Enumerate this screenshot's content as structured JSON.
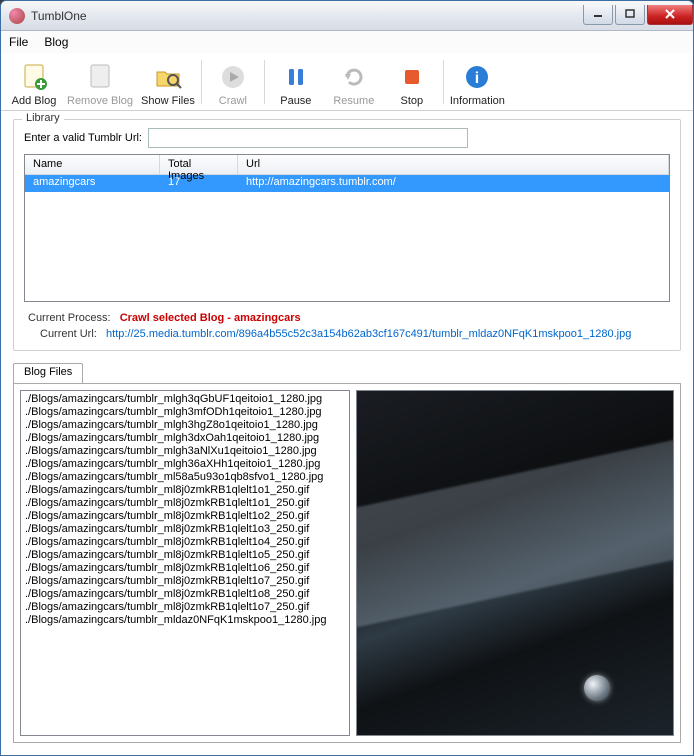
{
  "window": {
    "title": "TumblOne"
  },
  "menu": {
    "file": "File",
    "blog": "Blog"
  },
  "toolbar": {
    "add": "Add Blog",
    "remove": "Remove Blog",
    "showfiles": "Show Files",
    "crawl": "Crawl",
    "pause": "Pause",
    "resume": "Resume",
    "stop": "Stop",
    "info": "Information"
  },
  "library": {
    "title": "Library",
    "url_label": "Enter a valid Tumblr Url:",
    "url_value": "",
    "columns": {
      "name": "Name",
      "total": "Total Images",
      "url": "Url"
    },
    "rows": [
      {
        "name": "amazingcars",
        "total": "17",
        "url": "http://amazingcars.tumblr.com/"
      }
    ],
    "process_label": "Current Process:",
    "process_value": "Crawl selected Blog - amazingcars",
    "currenturl_label": "Current Url:",
    "currenturl_value": "http://25.media.tumblr.com/896a4b55c52c3a154b62ab3cf167c491/tumblr_mldaz0NFqK1mskpoo1_1280.jpg"
  },
  "blogfiles": {
    "tab": "Blog Files",
    "files": [
      "./Blogs/amazingcars/tumblr_mlgh3qGbUF1qeitoio1_1280.jpg",
      "./Blogs/amazingcars/tumblr_mlgh3mfODh1qeitoio1_1280.jpg",
      "./Blogs/amazingcars/tumblr_mlgh3hgZ8o1qeitoio1_1280.jpg",
      "./Blogs/amazingcars/tumblr_mlgh3dxOah1qeitoio1_1280.jpg",
      "./Blogs/amazingcars/tumblr_mlgh3aNlXu1qeitoio1_1280.jpg",
      "./Blogs/amazingcars/tumblr_mlgh36aXHh1qeitoio1_1280.jpg",
      "./Blogs/amazingcars/tumblr_ml58a5u93o1qb8sfvo1_1280.jpg",
      "./Blogs/amazingcars/tumblr_ml8j0zmkRB1qlelt1o1_250.gif",
      "./Blogs/amazingcars/tumblr_ml8j0zmkRB1qlelt1o1_250.gif",
      "./Blogs/amazingcars/tumblr_ml8j0zmkRB1qlelt1o2_250.gif",
      "./Blogs/amazingcars/tumblr_ml8j0zmkRB1qlelt1o3_250.gif",
      "./Blogs/amazingcars/tumblr_ml8j0zmkRB1qlelt1o4_250.gif",
      "./Blogs/amazingcars/tumblr_ml8j0zmkRB1qlelt1o5_250.gif",
      "./Blogs/amazingcars/tumblr_ml8j0zmkRB1qlelt1o6_250.gif",
      "./Blogs/amazingcars/tumblr_ml8j0zmkRB1qlelt1o7_250.gif",
      "./Blogs/amazingcars/tumblr_ml8j0zmkRB1qlelt1o8_250.gif",
      "./Blogs/amazingcars/tumblr_ml8j0zmkRB1qlelt1o7_250.gif",
      "./Blogs/amazingcars/tumblr_mldaz0NFqK1mskpoo1_1280.jpg"
    ]
  }
}
